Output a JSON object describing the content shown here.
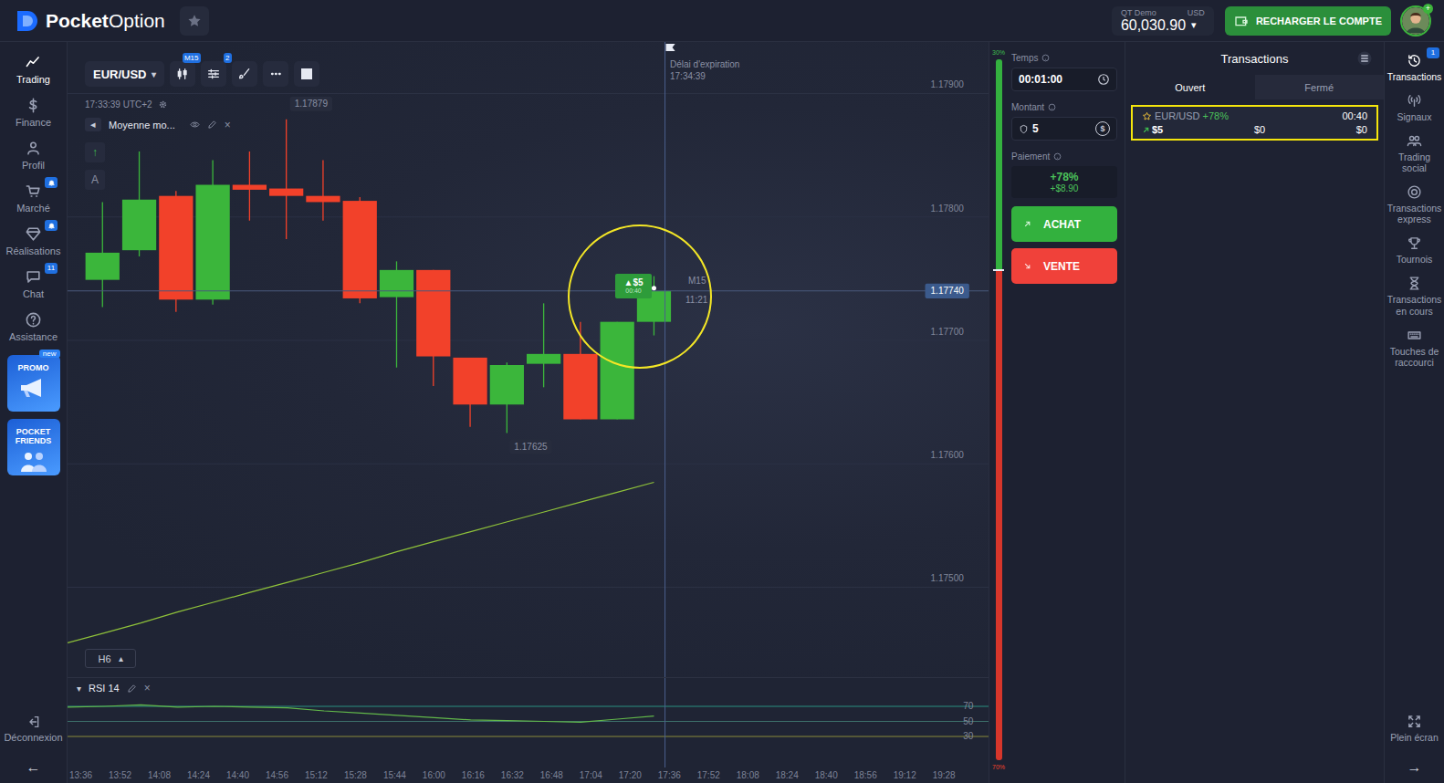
{
  "topbar": {
    "logo": {
      "bold": "Pocket",
      "light": "Option"
    },
    "account": {
      "type": "QT Demo",
      "currency": "USD",
      "balance": "60,030.90",
      "caret": "▾"
    },
    "recharge_button": "RECHARGER LE COMPTE",
    "avatar_badge": "+"
  },
  "left_sidebar": {
    "items": [
      {
        "label": "Trading",
        "selected": true,
        "badge": null,
        "alert": false
      },
      {
        "label": "Finance",
        "selected": false,
        "badge": null,
        "alert": false
      },
      {
        "label": "Profil",
        "selected": false,
        "badge": null,
        "alert": false
      },
      {
        "label": "Marché",
        "selected": false,
        "badge": null,
        "alert": true
      },
      {
        "label": "Réalisations",
        "selected": false,
        "badge": null,
        "alert": true
      },
      {
        "label": "Chat",
        "selected": false,
        "badge": "11",
        "alert": false
      },
      {
        "label": "Assistance",
        "selected": false,
        "badge": null,
        "alert": false
      }
    ],
    "promos": [
      {
        "label": "PROMO",
        "tag": "new"
      },
      {
        "label": "POCKET FRIENDS",
        "tag": null
      }
    ],
    "logout": "Déconnexion",
    "collapse": "←"
  },
  "chart": {
    "symbol": "EUR/USD",
    "symbol_caret": "▾",
    "toolbar_badges": [
      "M15",
      "2"
    ],
    "clock": "17:33:39 UTC+2",
    "indicator": {
      "collapse": "◂",
      "label": "Moyenne mo...",
      "close": "×"
    },
    "tools": [
      "↑",
      "A"
    ],
    "price_ticks": [
      "1.17900",
      "1.17800",
      "1.17700",
      "1.17600",
      "1.17500"
    ],
    "current_price": "1.17740",
    "high_label": "1.17879",
    "low_label": "1.17625",
    "candles": [
      {
        "open": 1.17749,
        "close": 1.17771,
        "high": 1.17812,
        "low": 1.17727
      },
      {
        "open": 1.17773,
        "close": 1.17814,
        "high": 1.17853,
        "low": 1.17768
      },
      {
        "open": 1.17817,
        "close": 1.17733,
        "high": 1.17821,
        "low": 1.17723
      },
      {
        "open": 1.17733,
        "close": 1.17826,
        "high": 1.17846,
        "low": 1.17729
      },
      {
        "open": 1.17826,
        "close": 1.17822,
        "high": 1.17853,
        "low": 1.17797
      },
      {
        "open": 1.17823,
        "close": 1.17817,
        "high": 1.17879,
        "low": 1.17782
      },
      {
        "open": 1.17817,
        "close": 1.17812,
        "high": 1.17846,
        "low": 1.17797
      },
      {
        "open": 1.17813,
        "close": 1.17734,
        "high": 1.17816,
        "low": 1.1773
      },
      {
        "open": 1.17735,
        "close": 1.17757,
        "high": 1.17764,
        "low": 1.17678
      },
      {
        "open": 1.17757,
        "close": 1.17687,
        "high": 1.17757,
        "low": 1.17663
      },
      {
        "open": 1.17686,
        "close": 1.17648,
        "high": 1.17686,
        "low": 1.1763
      },
      {
        "open": 1.17648,
        "close": 1.1768,
        "high": 1.17682,
        "low": 1.17625
      },
      {
        "open": 1.17681,
        "close": 1.17689,
        "high": 1.1773,
        "low": 1.17662
      },
      {
        "open": 1.17689,
        "close": 1.17636,
        "high": 1.17715,
        "low": 1.17636
      },
      {
        "open": 1.17636,
        "close": 1.17715,
        "high": 1.17715,
        "low": 1.17636
      },
      {
        "open": 1.17715,
        "close": 1.1774,
        "high": 1.17752,
        "low": 1.17704
      }
    ],
    "moving_average": [
      1.17455,
      1.17463,
      1.17471,
      1.1748,
      1.17488,
      1.17496,
      1.17504,
      1.17512,
      1.1752,
      1.17529,
      1.17537,
      1.17545,
      1.17553,
      1.17561,
      1.17569,
      1.17577,
      1.17585
    ],
    "expiration": {
      "label": "Délai d'expiration",
      "time": "17:34:39"
    },
    "trade_marker": {
      "text": "▲$5",
      "timer": "00:40",
      "highlighted": true
    },
    "candle_timer": {
      "timeframe": "M15",
      "remaining": "11:21"
    },
    "timeframe_button": {
      "label": "H6",
      "caret": "▴"
    },
    "rsi": {
      "caret": "▾",
      "label": "RSI 14",
      "close": "×",
      "levels": [
        "70",
        "50",
        "30"
      ],
      "values": [
        69,
        70,
        72,
        69,
        70,
        69,
        68,
        64,
        61,
        58,
        55,
        52,
        51,
        50,
        49,
        53,
        57
      ]
    },
    "time_axis": [
      "13:36",
      "13:52",
      "14:08",
      "14:24",
      "14:40",
      "14:56",
      "15:12",
      "15:28",
      "15:44",
      "16:00",
      "16:16",
      "16:32",
      "16:48",
      "17:04",
      "17:20",
      "17:36",
      "17:52",
      "18:08",
      "18:24",
      "18:40",
      "18:56",
      "19:12",
      "19:28"
    ]
  },
  "sentiment": {
    "up": "30%",
    "down": "70%",
    "level": 0.3
  },
  "trade_panel": {
    "time": {
      "label": "Temps",
      "value": "00:01:00"
    },
    "amount": {
      "label": "Montant",
      "value": "5",
      "currency_icon": "$"
    },
    "payout": {
      "label": "Paiement",
      "percent": "+78%",
      "profit": "+$8.90"
    },
    "buy": "ACHAT",
    "sell": "VENTE"
  },
  "transactions": {
    "title": "Transactions",
    "tabs": [
      {
        "label": "Ouvert",
        "selected": true
      },
      {
        "label": "Fermé",
        "selected": false
      }
    ],
    "items": [
      {
        "favorite": false,
        "symbol": "EUR/USD",
        "payout": "+78%",
        "timer": "00:40",
        "direction": "up",
        "amount": "$5",
        "profit": "$0",
        "result": "$0",
        "highlighted": true
      }
    ]
  },
  "right_sidebar": {
    "items": [
      {
        "label": "Transactions",
        "selected": true,
        "badge": "1"
      },
      {
        "label": "Signaux",
        "selected": false,
        "badge": null
      },
      {
        "label": "Trading social",
        "selected": false,
        "badge": null
      },
      {
        "label": "Transactions express",
        "selected": false,
        "badge": null
      },
      {
        "label": "Tournois",
        "selected": false,
        "badge": null
      },
      {
        "label": "Transactions en cours",
        "selected": false,
        "badge": null
      },
      {
        "label": "Touches de raccourci",
        "selected": false,
        "badge": null
      }
    ],
    "fullscreen": "Plein écran",
    "expand": "→"
  }
}
